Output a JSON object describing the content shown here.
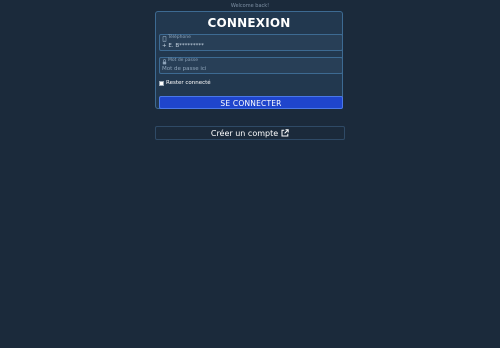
{
  "header": {
    "welcome_text": "Welcome back!"
  },
  "login": {
    "title": "CONNEXION",
    "phone": {
      "label": "Téléphone",
      "value": "+ E. B*********",
      "icon": "phone-icon"
    },
    "password": {
      "label": "Mot de passe",
      "placeholder": "Mot de passe ici",
      "icon": "lock-icon"
    },
    "remember_me": {
      "label": "Rester connecté",
      "checked": false
    },
    "submit_label": "SE CONNECTER"
  },
  "signup": {
    "label": "Créer un compte",
    "icon": "external-link-icon"
  },
  "colors": {
    "background": "#1b2a3b",
    "card": "#22384f",
    "border": "#3d6a92",
    "primary_button": "#1f45cc"
  }
}
